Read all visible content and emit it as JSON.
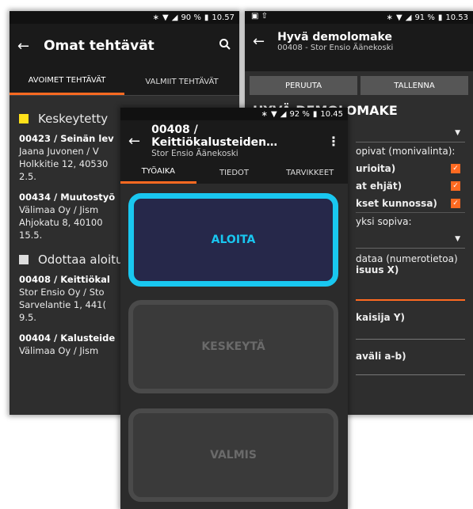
{
  "colors": {
    "accent": "#ff6a21",
    "aloita_bg": "#26284a",
    "aloita_border": "#19c7f0",
    "pending": "#dddddd",
    "paused": "#ffe11a"
  },
  "phone1": {
    "status": {
      "battery": "90 %",
      "time": "10.57"
    },
    "title": "Omat tehtävät",
    "icons": {
      "back": "arrow-back-icon",
      "search": "search-icon"
    },
    "tabs": [
      "AVOIMET TEHTÄVÄT",
      "VALMIIT TEHTÄVÄT"
    ],
    "sections": [
      {
        "label": "Keskeytetty",
        "items": [
          {
            "id": "00423 / Seinän lev",
            "line2": "Jaana Juvonen / V",
            "line3": "Holkkitie 12, 40530",
            "line4": "2.5."
          },
          {
            "id": "00434 / Muutostyö",
            "line2": "Välimaa Oy / Jism",
            "line3": "Ahjokatu 8, 40100",
            "line4": "15.5."
          }
        ]
      },
      {
        "label": "Odottaa aloitu",
        "items": [
          {
            "id": "00408 / Keittiökal",
            "line2": "Stor Ensio Oy / Sto",
            "line3": "Sarvelantie 1, 441(",
            "line4": "9.5."
          },
          {
            "id": "00404 / Kalusteide",
            "line2": "Välimaa Oy / Jism",
            "line3": "",
            "line4": ""
          }
        ]
      }
    ]
  },
  "phone2": {
    "status": {
      "battery": "91 %",
      "time": "10.53"
    },
    "title": "Hyvä demolomake",
    "subtitle": "00408 - Stor Ensio Äänekoski",
    "buttons": {
      "cancel": "PERUUTA",
      "save": "TALLENNA"
    },
    "form_title": "HYVÄ DEMOLOMAKE",
    "lines": {
      "l1": "opivat (monivalinta):",
      "l2": "urioita)",
      "l3": "at ehjät)",
      "l4": "kset kunnossa)",
      "l5": "yksi sopiva:",
      "l6": "dataa (numerotietoa)",
      "l7": "isuus X)",
      "l8": "kaisija Y)",
      "l9": "aväli a-b)"
    }
  },
  "phone3": {
    "status": {
      "battery": "92 %",
      "time": "10.45"
    },
    "title": "00408 / Keittiökalusteiden…",
    "subtitle": "Stor Ensio Äänekoski",
    "tabs": [
      "TYÖAIKA",
      "TIEDOT",
      "TARVIKKEET"
    ],
    "actions": {
      "start": "ALOITA",
      "pause": "KESKEYTÄ",
      "done": "VALMIS"
    }
  }
}
